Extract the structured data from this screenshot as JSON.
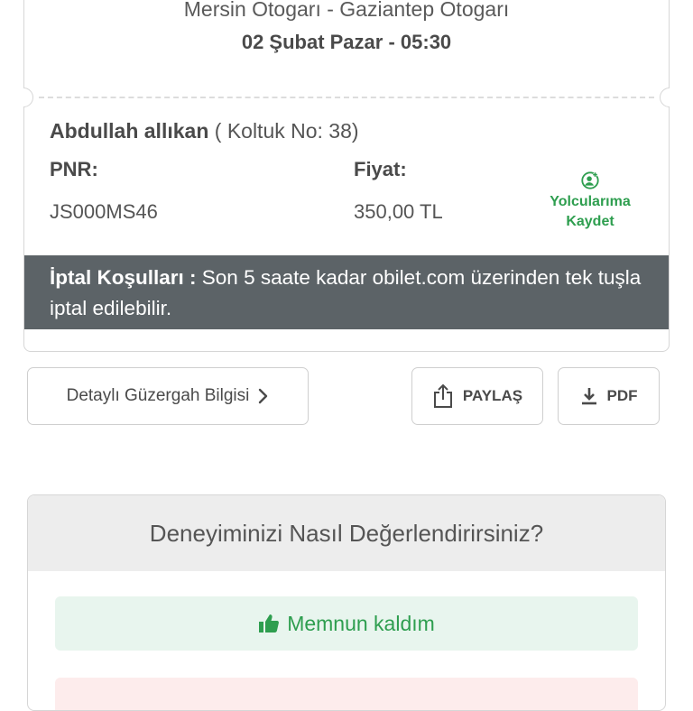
{
  "ticket": {
    "route": "Mersin Otogarı - Gaziantep Otogarı",
    "datetime": "02 Şubat Pazar - 05:30",
    "passenger_name": "Abdullah allıkan",
    "seat_text": " ( Koltuk No: 38)",
    "pnr_label": "PNR:",
    "pnr_value": "JS000MS46",
    "price_label": "Fiyat:",
    "price_value": "350,00 TL",
    "save_line1": "Yolcularıma",
    "save_line2": "Kaydet",
    "cancel_title": "İptal Koşulları : ",
    "cancel_text": "Son 5 saate kadar obilet.com üzerinden tek tuşla iptal edilebilir."
  },
  "actions": {
    "route_details": "Detaylı Güzergah Bilgisi",
    "share": "PAYLAŞ",
    "pdf": "PDF"
  },
  "rating": {
    "title": "Deneyiminizi Nasıl Değerlendirirsiniz?",
    "positive": "Memnun kaldım"
  },
  "colors": {
    "accent_green": "#2e9e4f",
    "cancel_bar": "#5c6367"
  }
}
